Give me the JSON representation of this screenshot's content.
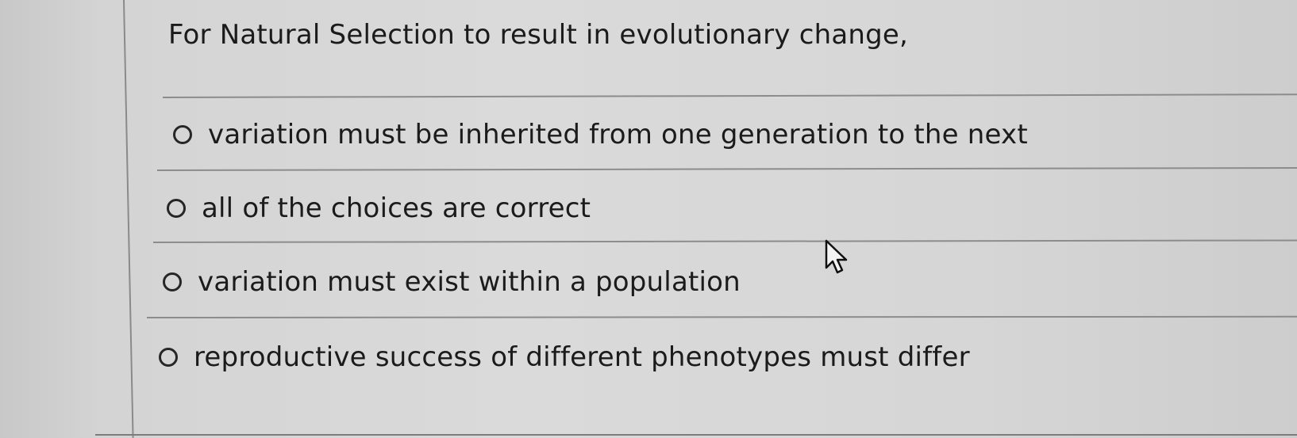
{
  "question": {
    "text": "For Natural Selection to result in evolutionary change,"
  },
  "options": [
    {
      "label": "variation must be inherited  from one generation to the next"
    },
    {
      "label": "all of the choices are correct"
    },
    {
      "label": "variation must exist within a population"
    },
    {
      "label": "reproductive success of different phenotypes must differ"
    }
  ],
  "icons": {
    "cursor": "arrow-pointer-icon",
    "radio": "radio-button-unselected"
  },
  "colors": {
    "background": "#d6d6d6",
    "text": "#1b1b1b",
    "divider": "#8c8c8c"
  }
}
